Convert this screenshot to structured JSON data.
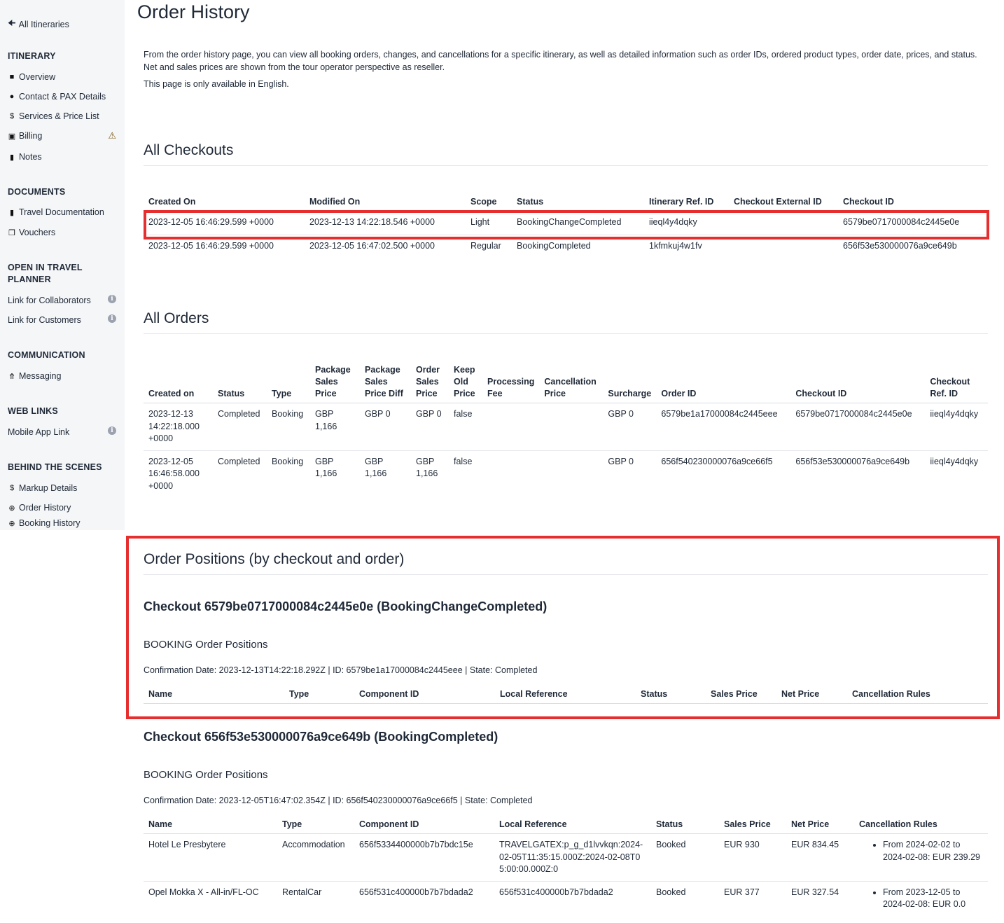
{
  "sidebar": {
    "back": "All Itineraries",
    "itinerary_title": "ITINERARY",
    "itinerary_items": [
      "Overview",
      "Contact & PAX Details",
      "Services & Price List",
      "Billing",
      "Notes"
    ],
    "documents_title": "DOCUMENTS",
    "documents_items": [
      "Travel Documentation",
      "Vouchers"
    ],
    "planner_title": "OPEN IN TRAVEL PLANNER",
    "planner_items": [
      "Link for Collaborators",
      "Link for Customers"
    ],
    "communication_title": "COMMUNICATION",
    "communication_items": [
      "Messaging"
    ],
    "weblinks_title": "WEB LINKS",
    "weblinks_items": [
      "Mobile App Link"
    ],
    "behind_title": "BEHIND THE SCENES",
    "behind_items": [
      "Markup Details",
      "Order History",
      "Booking History"
    ]
  },
  "page": {
    "title": "Order History",
    "intro": "From the order history page, you can view all booking orders, changes, and cancellations for a specific itinerary, as well as detailed information such as order IDs, ordered product types, order date, prices, and status. Net and sales prices are shown from the tour operator perspective as reseller.",
    "intro2": "This page is only available in English."
  },
  "checkouts": {
    "title": "All Checkouts",
    "headers": [
      "Created On",
      "Modified On",
      "Scope",
      "Status",
      "Itinerary Ref. ID",
      "Checkout External ID",
      "Checkout ID"
    ],
    "rows": [
      [
        "2023-12-05 16:46:29.599 +0000",
        "2023-12-13 14:22:18.546 +0000",
        "Light",
        "BookingChangeCompleted",
        "iieql4y4dqky",
        "",
        "6579be0717000084c2445e0e"
      ],
      [
        "2023-12-05 16:46:29.599 +0000",
        "2023-12-05 16:47:02.500 +0000",
        "Regular",
        "BookingCompleted",
        "1kfmkuj4w1fv",
        "",
        "656f53e530000076a9ce649b"
      ]
    ]
  },
  "orders": {
    "title": "All Orders",
    "headers": [
      "Created on",
      "Status",
      "Type",
      "Package Sales Price",
      "Package Sales Price Diff",
      "Order Sales Price",
      "Keep Old Price",
      "Processing Fee",
      "Cancellation Price",
      "Surcharge",
      "Order ID",
      "Checkout ID",
      "Checkout Ref. ID"
    ],
    "rows": [
      [
        "2023-12-13 14:22:18.000 +0000",
        "Completed",
        "Booking",
        "GBP 1,166",
        "GBP 0",
        "GBP 0",
        "false",
        "",
        "",
        "GBP 0",
        "6579be1a17000084c2445eee",
        "6579be0717000084c2445e0e",
        "iieql4y4dqky"
      ],
      [
        "2023-12-05 16:46:58.000 +0000",
        "Completed",
        "Booking",
        "GBP 1,166",
        "GBP 1,166",
        "GBP 1,166",
        "false",
        "",
        "",
        "GBP 0",
        "656f540230000076a9ce66f5",
        "656f53e530000076a9ce649b",
        "iieql4y4dqky"
      ]
    ]
  },
  "positions": {
    "title": "Order Positions (by checkout and order)",
    "checkout1": {
      "heading": "Checkout 6579be0717000084c2445e0e (BookingChangeCompleted)",
      "sub": "BOOKING Order Positions",
      "conf": "Confirmation Date: 2023-12-13T14:22:18.292Z | ID: 6579be1a17000084c2445eee | State: Completed",
      "headers": [
        "Name",
        "Type",
        "Component ID",
        "Local Reference",
        "Status",
        "Sales Price",
        "Net Price",
        "Cancellation Rules"
      ]
    },
    "checkout2": {
      "heading": "Checkout 656f53e530000076a9ce649b (BookingCompleted)",
      "sub": "BOOKING Order Positions",
      "conf": "Confirmation Date: 2023-12-05T16:47:02.354Z | ID: 656f540230000076a9ce66f5 | State: Completed",
      "headers": [
        "Name",
        "Type",
        "Component ID",
        "Local Reference",
        "Status",
        "Sales Price",
        "Net Price",
        "Cancellation Rules"
      ],
      "rows": [
        [
          "Hotel Le Presbytere",
          "Accommodation",
          "656f5334400000b7b7bdc15e",
          "TRAVELGATEX:p_g_d1lvvkqn:2024-02-05T11:35:15.000Z:2024-02-08T05:00:00.000Z:0",
          "Booked",
          "EUR 930",
          "EUR 834.45",
          "From 2024-02-02 to 2024-02-08: EUR 239.29"
        ],
        [
          "Opel Mokka X - All-in/FL-OC",
          "RentalCar",
          "656f531c400000b7b7bdada2",
          "656f531c400000b7b7bdada2",
          "Booked",
          "EUR 377",
          "EUR 327.54",
          "From 2023-12-05 to 2024-02-08: EUR 0.0"
        ]
      ]
    }
  },
  "colors": {
    "highlight": "#e62e2e",
    "sidebar_bg": "#f5f6f8",
    "text": "#1f2937"
  },
  "icons": [
    "arrow-left-icon",
    "folder-icon",
    "user-icon",
    "dollar-icon",
    "credit-card-icon",
    "warning-icon",
    "comment-icon",
    "book-icon",
    "gift-icon",
    "info-icon",
    "arrow-circle-up-icon",
    "search-plus-icon"
  ]
}
